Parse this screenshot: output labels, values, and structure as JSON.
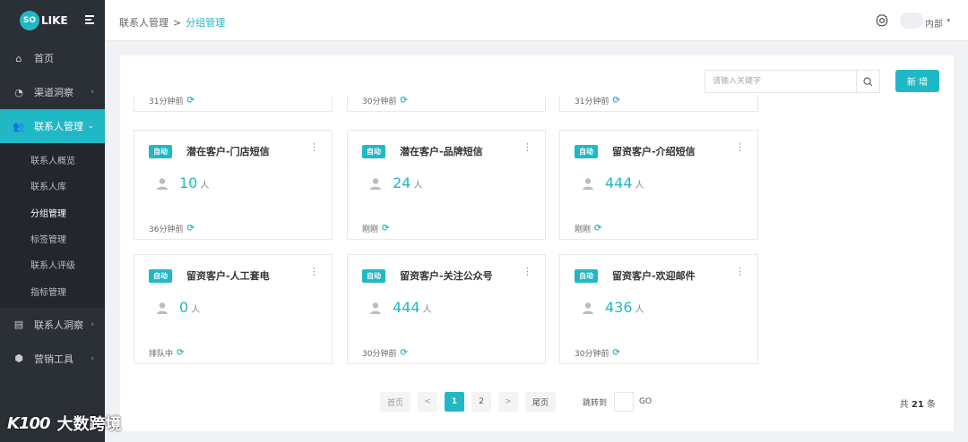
{
  "brand": {
    "logo_circle": "SO",
    "logo_text": "LIKE"
  },
  "sidebar": {
    "items": [
      {
        "label": "首页",
        "icon": "home-icon",
        "glyph": "⌂"
      },
      {
        "label": "渠道洞察",
        "icon": "pie-chart-icon",
        "glyph": "◔"
      },
      {
        "label": "联系人管理",
        "icon": "users-icon",
        "glyph": "👥"
      },
      {
        "label": "联系人洞察",
        "icon": "id-card-icon",
        "glyph": "▤"
      },
      {
        "label": "营销工具",
        "icon": "cubes-icon",
        "glyph": "⬢"
      }
    ],
    "sub_items": [
      "联系人概览",
      "联系人库",
      "分组管理",
      "标签管理",
      "联系人评级",
      "指标管理"
    ]
  },
  "header": {
    "breadcrumb_parent": "联系人管理",
    "breadcrumb_sep": ">",
    "breadcrumb_current": "分组管理",
    "user_name": "内部",
    "user_caret": "▾"
  },
  "toolbar": {
    "search_placeholder": "请输入关键字",
    "new_label": "新 增"
  },
  "cards_partial": [
    {
      "time": "31分钟前"
    },
    {
      "time": "30分钟前"
    },
    {
      "time": "31分钟前"
    }
  ],
  "cards": [
    {
      "tag": "自动",
      "title": "潜在客户-门店短信",
      "count": "10",
      "unit": "人",
      "time": "36分钟前"
    },
    {
      "tag": "自动",
      "title": "潜在客户-品牌短信",
      "count": "24",
      "unit": "人",
      "time": "刚刚"
    },
    {
      "tag": "自动",
      "title": "留资客户-介绍短信",
      "count": "444",
      "unit": "人",
      "time": "刚刚"
    },
    {
      "tag": "自动",
      "title": "留资客户-人工套电",
      "count": "0",
      "unit": "人",
      "time": "排队中"
    },
    {
      "tag": "自动",
      "title": "留资客户-关注公众号",
      "count": "444",
      "unit": "人",
      "time": "30分钟前"
    },
    {
      "tag": "自动",
      "title": "留资客户-欢迎邮件",
      "count": "436",
      "unit": "人",
      "time": "30分钟前"
    }
  ],
  "pagination": {
    "first": "首页",
    "prev": "<",
    "pages": [
      "1",
      "2"
    ],
    "current_page": "1",
    "next": ">",
    "last": "尾页",
    "jump_label": "跳转到",
    "go": "GO",
    "total_prefix": "共",
    "total": "21",
    "total_suffix": "条"
  },
  "watermark": {
    "logo": "K100",
    "text": "大数跨境"
  },
  "colors": {
    "accent": "#21b8c5",
    "sidebar_bg": "#2b2f36",
    "sidebar_sub_bg": "#23272d"
  }
}
